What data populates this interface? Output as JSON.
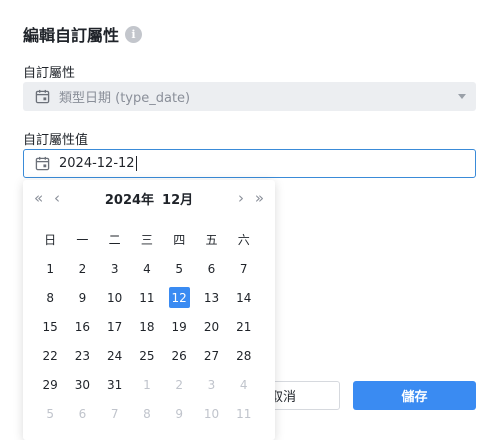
{
  "dialog": {
    "title": "編輯自訂屬性",
    "info_icon": "i"
  },
  "field_custom_attr": {
    "label": "自訂屬性",
    "value": "類型日期 (type_date)",
    "icon": "calendar-icon"
  },
  "field_value": {
    "label": "自訂屬性值",
    "value": "2024-12-12",
    "icon": "calendar-icon"
  },
  "buttons": {
    "cancel": "取消",
    "save": "儲存"
  },
  "colors": {
    "accent": "#3a8bf2",
    "input_focus_border": "#3a8bd8",
    "disabled_bg": "#eceef1"
  },
  "calendar": {
    "year_label": "2024年",
    "month_label": "12月",
    "prev_year": "«",
    "prev_month": "‹",
    "next_month": "›",
    "next_year": "»",
    "weekdays": [
      "日",
      "一",
      "二",
      "三",
      "四",
      "五",
      "六"
    ],
    "selected_day": "12",
    "weeks": [
      [
        {
          "d": "1",
          "m": false
        },
        {
          "d": "2",
          "m": false
        },
        {
          "d": "3",
          "m": false
        },
        {
          "d": "4",
          "m": false
        },
        {
          "d": "5",
          "m": false
        },
        {
          "d": "6",
          "m": false
        },
        {
          "d": "7",
          "m": false
        }
      ],
      [
        {
          "d": "8",
          "m": false
        },
        {
          "d": "9",
          "m": false
        },
        {
          "d": "10",
          "m": false
        },
        {
          "d": "11",
          "m": false
        },
        {
          "d": "12",
          "m": false,
          "s": true
        },
        {
          "d": "13",
          "m": false
        },
        {
          "d": "14",
          "m": false
        }
      ],
      [
        {
          "d": "15",
          "m": false
        },
        {
          "d": "16",
          "m": false
        },
        {
          "d": "17",
          "m": false
        },
        {
          "d": "18",
          "m": false
        },
        {
          "d": "19",
          "m": false
        },
        {
          "d": "20",
          "m": false
        },
        {
          "d": "21",
          "m": false
        }
      ],
      [
        {
          "d": "22",
          "m": false
        },
        {
          "d": "23",
          "m": false
        },
        {
          "d": "24",
          "m": false
        },
        {
          "d": "25",
          "m": false
        },
        {
          "d": "26",
          "m": false
        },
        {
          "d": "27",
          "m": false
        },
        {
          "d": "28",
          "m": false
        }
      ],
      [
        {
          "d": "29",
          "m": false
        },
        {
          "d": "30",
          "m": false
        },
        {
          "d": "31",
          "m": false
        },
        {
          "d": "1",
          "m": true
        },
        {
          "d": "2",
          "m": true
        },
        {
          "d": "3",
          "m": true
        },
        {
          "d": "4",
          "m": true
        }
      ],
      [
        {
          "d": "5",
          "m": true
        },
        {
          "d": "6",
          "m": true
        },
        {
          "d": "7",
          "m": true
        },
        {
          "d": "8",
          "m": true
        },
        {
          "d": "9",
          "m": true
        },
        {
          "d": "10",
          "m": true
        },
        {
          "d": "11",
          "m": true
        }
      ]
    ]
  }
}
